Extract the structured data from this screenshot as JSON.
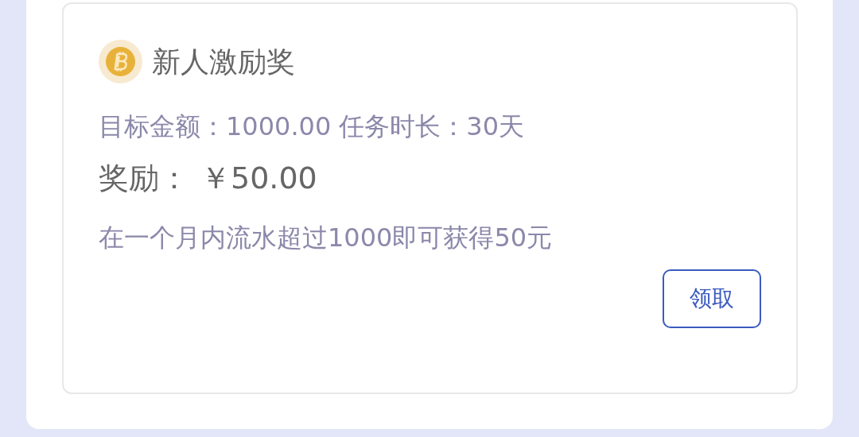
{
  "card": {
    "title": "新人激励奖",
    "stats": [
      "目标金额：1000.00",
      "任务时长：30天"
    ],
    "reward_label": "奖励：",
    "reward_amount": "￥50.00",
    "description": "在一个月内流水超过1000即可获得50元",
    "claim_button": "领取"
  }
}
